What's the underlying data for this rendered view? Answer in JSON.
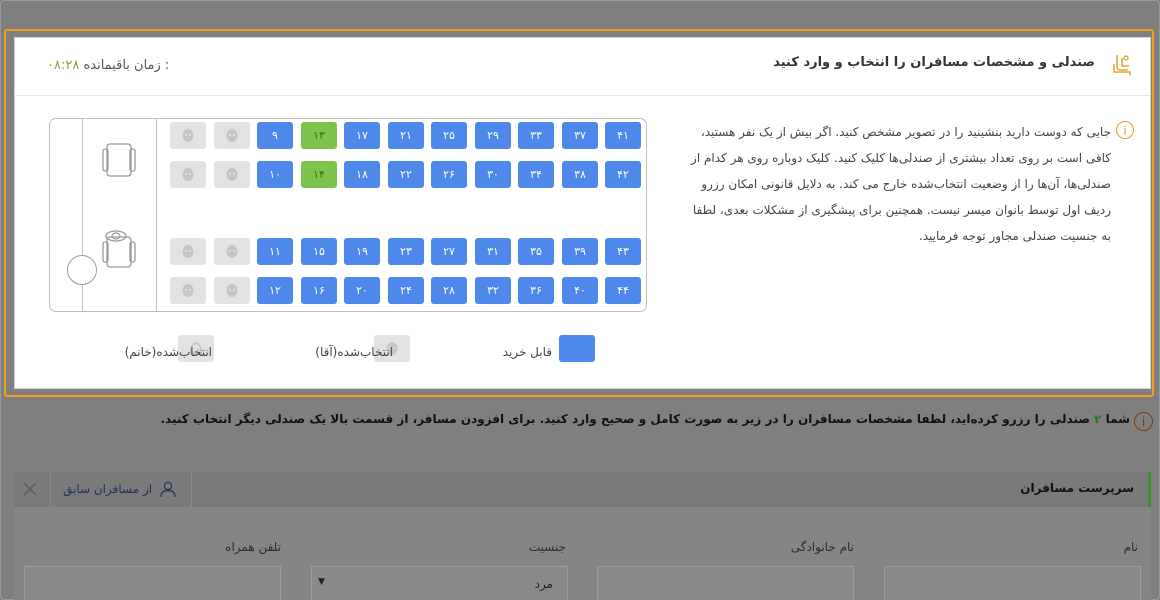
{
  "dialog": {
    "title": "صندلی و مشخصات مسافران را انتخاب و وارد کنید",
    "timer_label": "زمان باقیمانده :",
    "timer_value": "۰۸:۲۸",
    "info_text": "جایی که دوست دارید بنشینید را در تصویر مشخص کنید. اگر بیش از یک نفر هستید، کافی است بر روی تعداد بیشتری از صندلی‌ها کلیک کنید. کلیک دوباره روی هر کدام از صندلی‌ها، آن‌ها را از وضعیت انتخاب‌شده خارج می کند. به دلایل قانونی امکان رزرو ردیف اول توسط بانوان میسر نیست. همچنین برای پیشگیری از مشکلات بعدی، لطفا به جنسیت صندلی مجاور توجه فرمایید."
  },
  "seats": {
    "rows": [
      [
        "۴۱",
        "۳۷",
        "۳۳",
        "۲۹",
        "۲۵",
        "۲۱",
        "۱۷",
        "۱۳",
        "۹"
      ],
      [
        "۴۲",
        "۳۸",
        "۳۴",
        "۳۰",
        "۲۶",
        "۲۲",
        "۱۸",
        "۱۴",
        "۱۰"
      ],
      [
        "۴۳",
        "۳۹",
        "۳۵",
        "۳۱",
        "۲۷",
        "۲۳",
        "۱۹",
        "۱۵",
        "۱۱"
      ],
      [
        "۴۴",
        "۴۰",
        "۳۶",
        "۳۲",
        "۲۸",
        "۲۴",
        "۲۰",
        "۱۶",
        "۱۲"
      ]
    ],
    "selected": [
      "۱۳",
      "۱۴"
    ],
    "taken_per_row": 2
  },
  "legend": {
    "available": "قابل خرید",
    "taken_male": "انتخاب‌شده(آقا)",
    "taken_female": "انتخاب‌شده(خانم)"
  },
  "notice": {
    "prefix": "شما",
    "count": "۲",
    "text": "صندلی را رزرو کرده‌اید، لطفا مشخصات مسافران را در زیر به صورت کامل و صحیح وارد کنید. برای افزودن مسافر، از قسمت بالا یک صندلی دیگر انتخاب کنید."
  },
  "passenger_form": {
    "section_title": "سرپرست مسافران",
    "previous_button": "از مسافران سابق",
    "fields": {
      "first_name": "نام",
      "last_name": "نام خانوادگی",
      "gender": "جنسیت",
      "gender_value": "مرد",
      "phone": "تلفن همراه"
    }
  },
  "colors": {
    "available": "#4e88ea",
    "selected": "#7cc24b",
    "taken": "#e2e2e2",
    "highlight": "#f2a114"
  }
}
